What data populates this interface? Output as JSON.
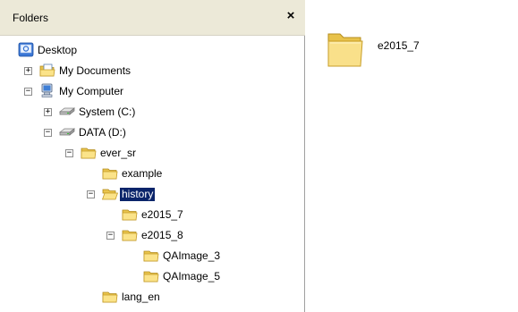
{
  "folders_pane": {
    "title": "Folders",
    "close_label": "×"
  },
  "tree": [
    {
      "label": "Desktop",
      "icon": "desktop-icon",
      "expander": "",
      "level": 0
    },
    {
      "label": "My Documents",
      "icon": "documents-folder-icon",
      "expander": "+",
      "level": 1
    },
    {
      "label": "My Computer",
      "icon": "computer-icon",
      "expander": "−",
      "level": 1
    },
    {
      "label": "System (C:)",
      "icon": "drive-icon",
      "expander": "+",
      "level": 2
    },
    {
      "label": "DATA (D:)",
      "icon": "drive-icon",
      "expander": "−",
      "level": 2
    },
    {
      "label": "ever_sr",
      "icon": "folder-icon",
      "expander": "−",
      "level": 3
    },
    {
      "label": "example",
      "icon": "folder-icon",
      "expander": "",
      "level": 4
    },
    {
      "label": "history",
      "icon": "folder-open-icon",
      "expander": "−",
      "level": 4,
      "selected": true
    },
    {
      "label": "e2015_7",
      "icon": "folder-icon",
      "expander": "",
      "level": 5
    },
    {
      "label": "e2015_8",
      "icon": "folder-icon",
      "expander": "−",
      "level": 5
    },
    {
      "label": "QAImage_3",
      "icon": "folder-icon",
      "expander": "",
      "level": 6
    },
    {
      "label": "QAImage_5",
      "icon": "folder-icon",
      "expander": "",
      "level": 6
    },
    {
      "label": "lang_en",
      "icon": "folder-icon",
      "expander": "",
      "level": 4
    }
  ],
  "content": {
    "items": [
      {
        "label": "e2015_7",
        "icon": "folder-icon"
      }
    ]
  }
}
